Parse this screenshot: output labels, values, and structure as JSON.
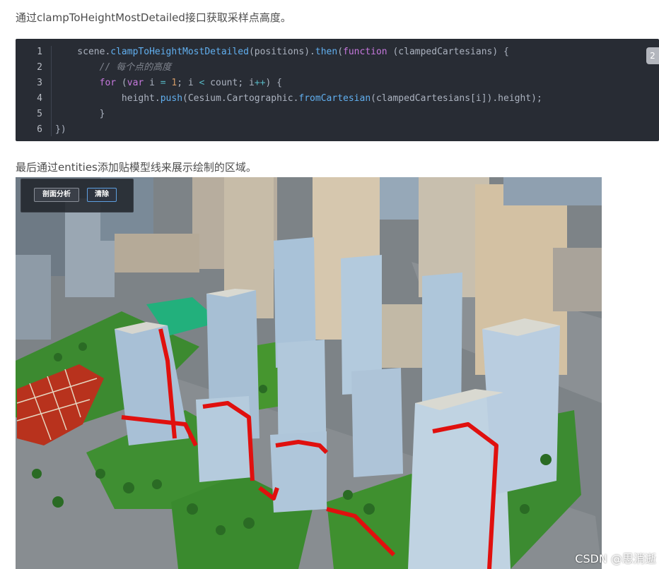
{
  "article": {
    "para1": "通过clampToHeightMostDetailed接口获取采样点高度。",
    "para2": "最后通过entities添加贴模型线来展示绘制的区域。"
  },
  "code": {
    "line_numbers": [
      "1",
      "2",
      "3",
      "4",
      "5",
      "6"
    ],
    "line1": {
      "a": "    scene.",
      "b": "clampToHeightMostDetailed",
      "c": "(positions).",
      "d": "then",
      "e": "(",
      "f": "function",
      "g": " (clampedCartesians) {"
    },
    "line2": {
      "a": "        ",
      "b": "// 每个点的高度"
    },
    "line3": {
      "a": "        ",
      "b": "for",
      "c": " (",
      "d": "var",
      "e": " i ",
      "f": "=",
      "g": " ",
      "h": "1",
      "i": "; i ",
      "j": "<",
      "k": " count; i",
      "l": "++",
      "m": ") {"
    },
    "line4": {
      "a": "            height.",
      "b": "push",
      "c": "(Cesium.Cartographic.",
      "d": "fromCartesian",
      "e": "(clampedCartesians[i]).height);"
    },
    "line5": {
      "a": "        }"
    },
    "line6": {
      "a": "})"
    },
    "copy_glyph": "2"
  },
  "toolbar": {
    "profile_label": "剖面分析",
    "clear_label": "清除"
  },
  "watermark": "CSDN @思消逝"
}
